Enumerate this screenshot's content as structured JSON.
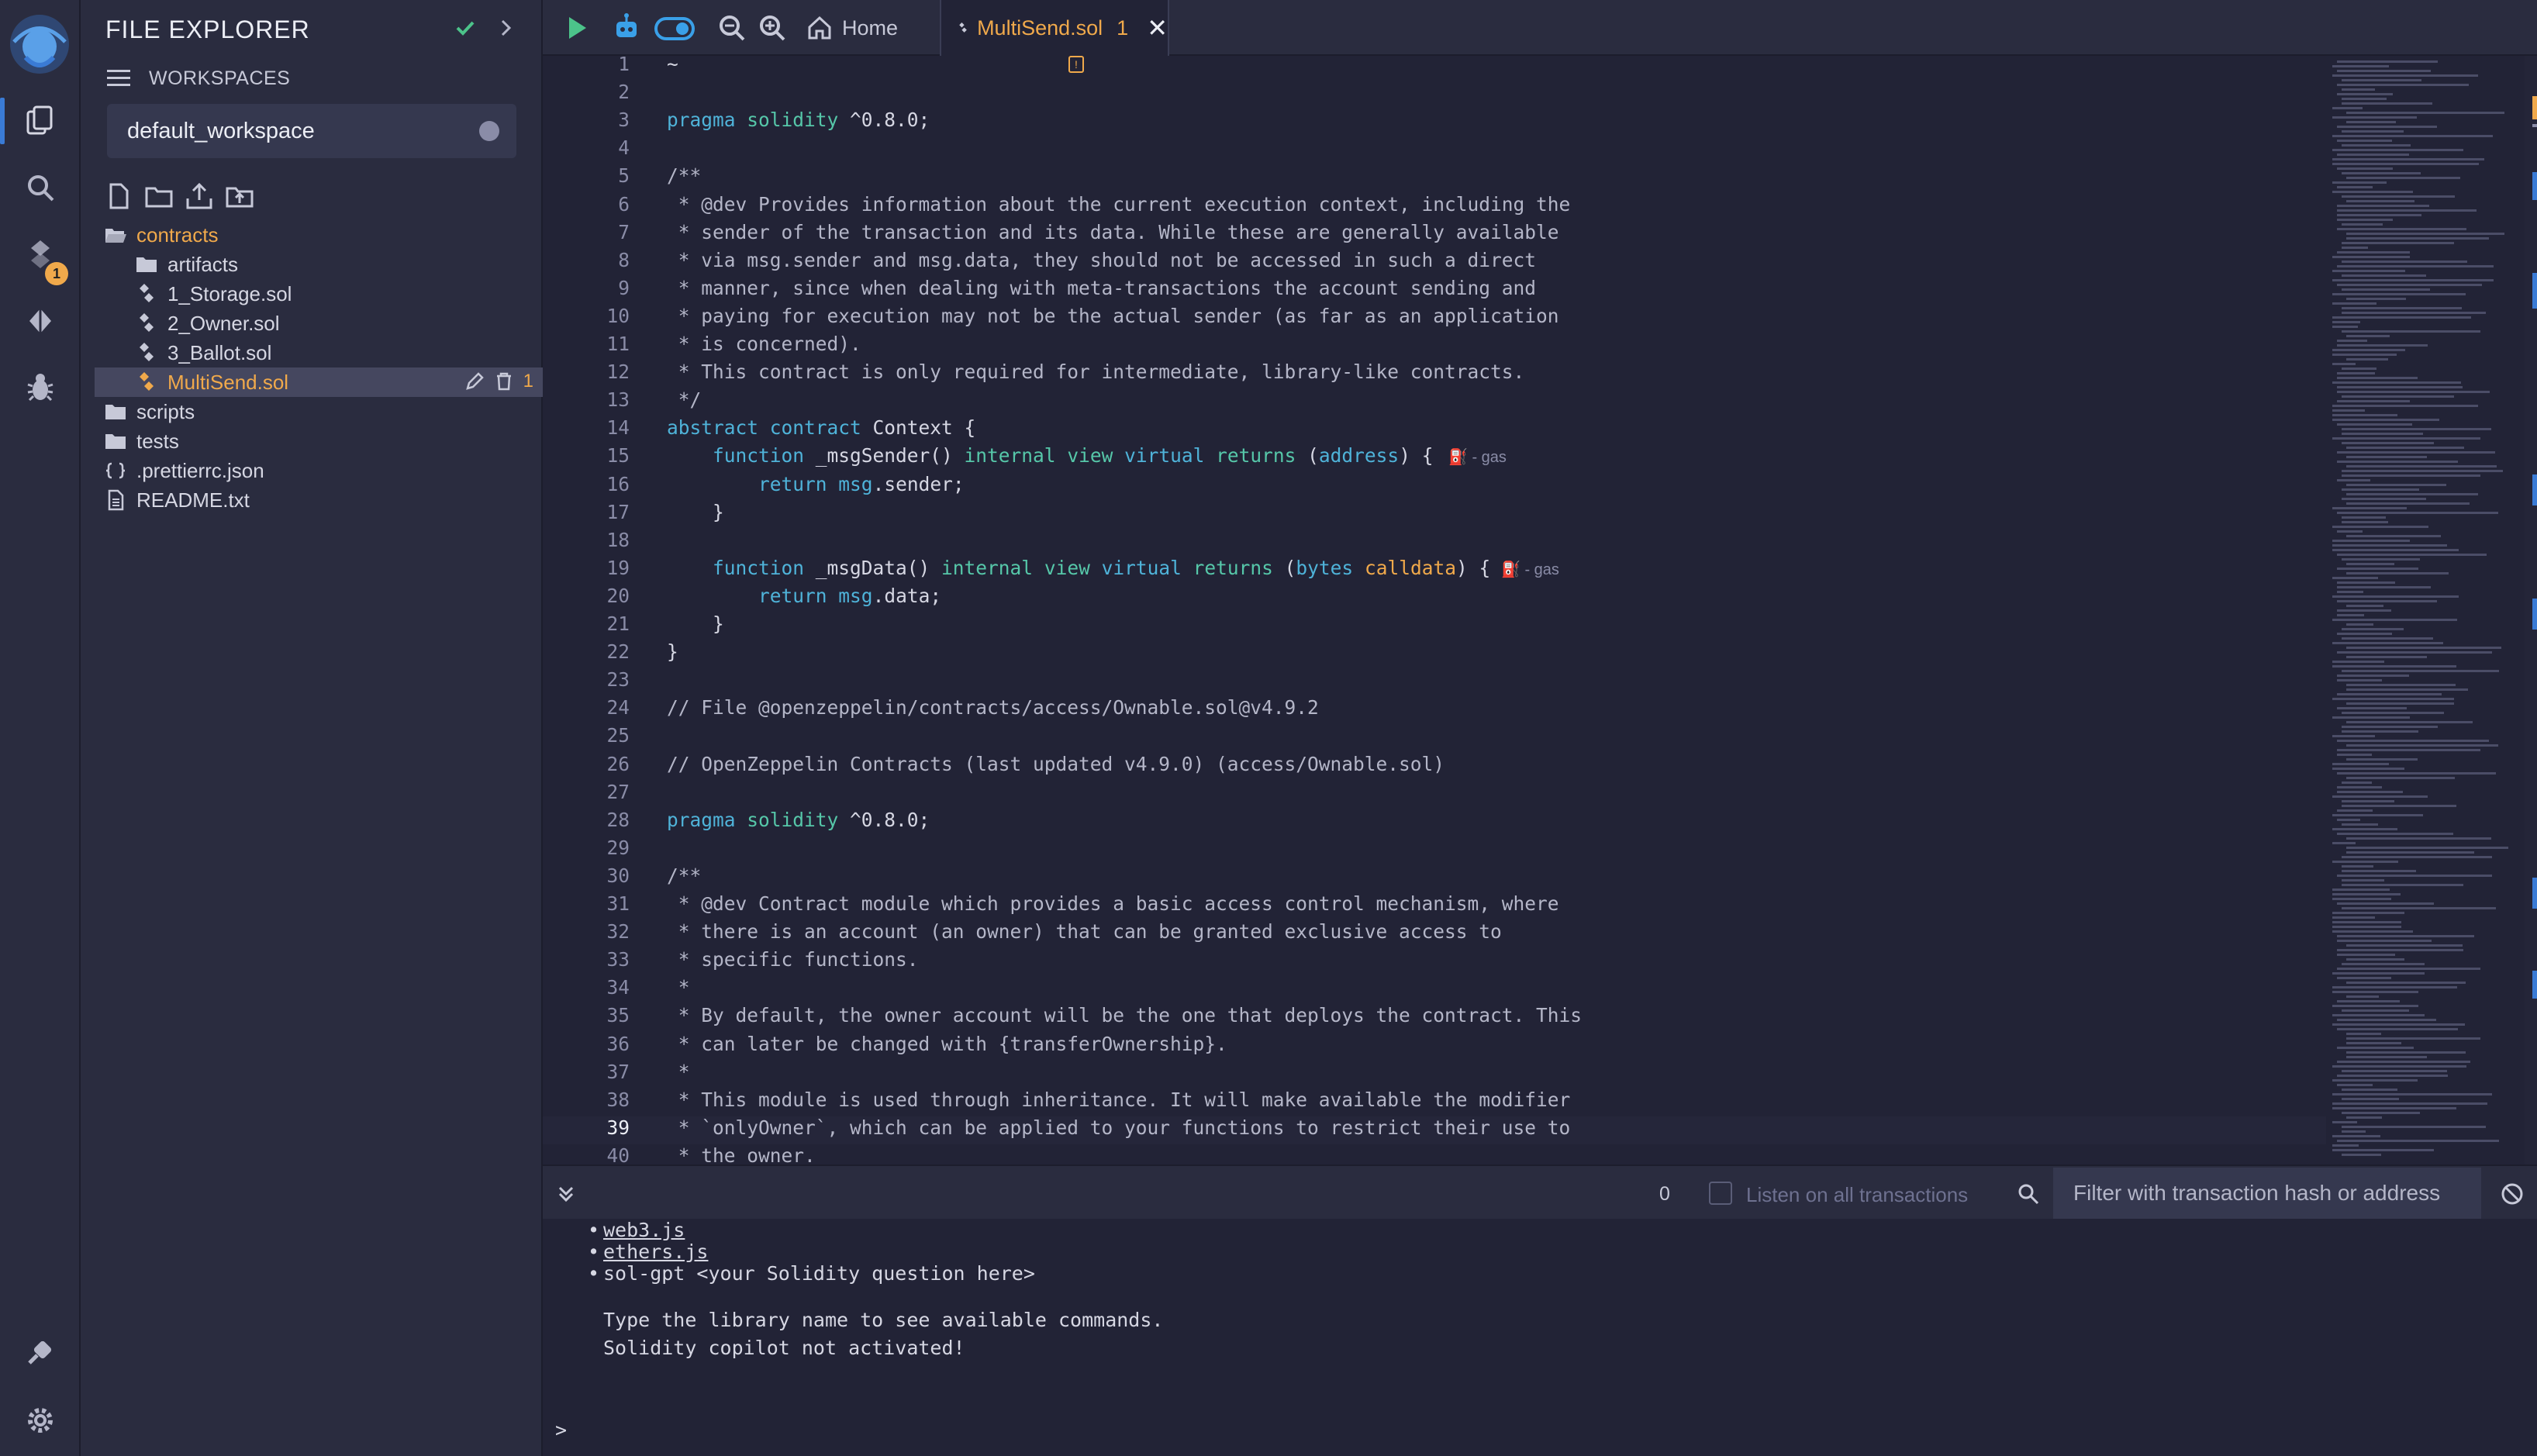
{
  "explorer": {
    "title": "FILE EXPLORER",
    "workspaces_label": "WORKSPACES",
    "workspace_selected": "default_workspace",
    "tree": [
      {
        "label": "contracts",
        "kind": "folder-open",
        "indent": 0
      },
      {
        "label": "artifacts",
        "kind": "folder",
        "indent": 1
      },
      {
        "label": "1_Storage.sol",
        "kind": "sol",
        "indent": 1
      },
      {
        "label": "2_Owner.sol",
        "kind": "sol",
        "indent": 1
      },
      {
        "label": "3_Ballot.sol",
        "kind": "sol",
        "indent": 1
      },
      {
        "label": "MultiSend.sol",
        "kind": "sol",
        "indent": 1,
        "selected": true,
        "problems": "1"
      },
      {
        "label": "scripts",
        "kind": "folder",
        "indent": 0
      },
      {
        "label": "tests",
        "kind": "folder",
        "indent": 0
      },
      {
        "label": ".prettierrc.json",
        "kind": "json",
        "indent": 0
      },
      {
        "label": "README.txt",
        "kind": "txt",
        "indent": 0
      }
    ]
  },
  "rail": {
    "badge_count": "1"
  },
  "tabs": {
    "home_label": "Home",
    "file_label": "MultiSend.sol",
    "file_problems": "1",
    "close_glyph": "✕"
  },
  "editor": {
    "current_line": 39,
    "line_numbers": [
      "1",
      "2",
      "3",
      "4",
      "5",
      "6",
      "7",
      "8",
      "9",
      "10",
      "11",
      "12",
      "13",
      "14",
      "15",
      "16",
      "17",
      "18",
      "19",
      "20",
      "21",
      "22",
      "23",
      "24",
      "25",
      "26",
      "27",
      "28",
      "29",
      "30",
      "31",
      "32",
      "33",
      "34",
      "35",
      "36",
      "37",
      "38",
      "39",
      "40"
    ],
    "lines": [
      "~",
      "",
      "pragma solidity ^0.8.0;",
      "",
      "/**",
      " * @dev Provides information about the current execution context, including the",
      " * sender of the transaction and its data. While these are generally available",
      " * via msg.sender and msg.data, they should not be accessed in such a direct",
      " * manner, since when dealing with meta-transactions the account sending and",
      " * paying for execution may not be the actual sender (as far as an application",
      " * is concerned).",
      " * This contract is only required for intermediate, library-like contracts.",
      " */",
      "abstract contract Context {",
      "    function _msgSender() internal view virtual returns (address) {",
      "        return msg.sender;",
      "    }",
      "",
      "    function _msgData() internal view virtual returns (bytes calldata) {",
      "        return msg.data;",
      "    }",
      "}",
      "",
      "// File @openzeppelin/contracts/access/Ownable.sol@v4.9.2",
      "",
      "// OpenZeppelin Contracts (last updated v4.9.0) (access/Ownable.sol)",
      "",
      "pragma solidity ^0.8.0;",
      "",
      "/**",
      " * @dev Contract module which provides a basic access control mechanism, where",
      " * there is an account (an owner) that can be granted exclusive access to",
      " * specific functions.",
      " *",
      " * By default, the owner account will be the one that deploys the contract. This",
      " * can later be changed with {transferOwnership}.",
      " *",
      " * This module is used through inheritance. It will make available the modifier",
      " * `onlyOwner`, which can be applied to your functions to restrict their use to",
      " * the owner."
    ],
    "gas_hint": "- gas"
  },
  "terminal": {
    "tx_count": "0",
    "listen_label": "Listen on all transactions",
    "filter_placeholder": "Filter with transaction hash or address",
    "bullets": [
      "web3.js",
      "ethers.js",
      "sol-gpt <your Solidity question here>"
    ],
    "lines": [
      "Type the library name to see available commands.",
      "Solidity copilot not activated!"
    ],
    "prompt": ">"
  },
  "colors": {
    "accent": "#f0a94b",
    "active": "#3a7bd5",
    "background": "#222336",
    "panel": "#2a2c3f"
  }
}
